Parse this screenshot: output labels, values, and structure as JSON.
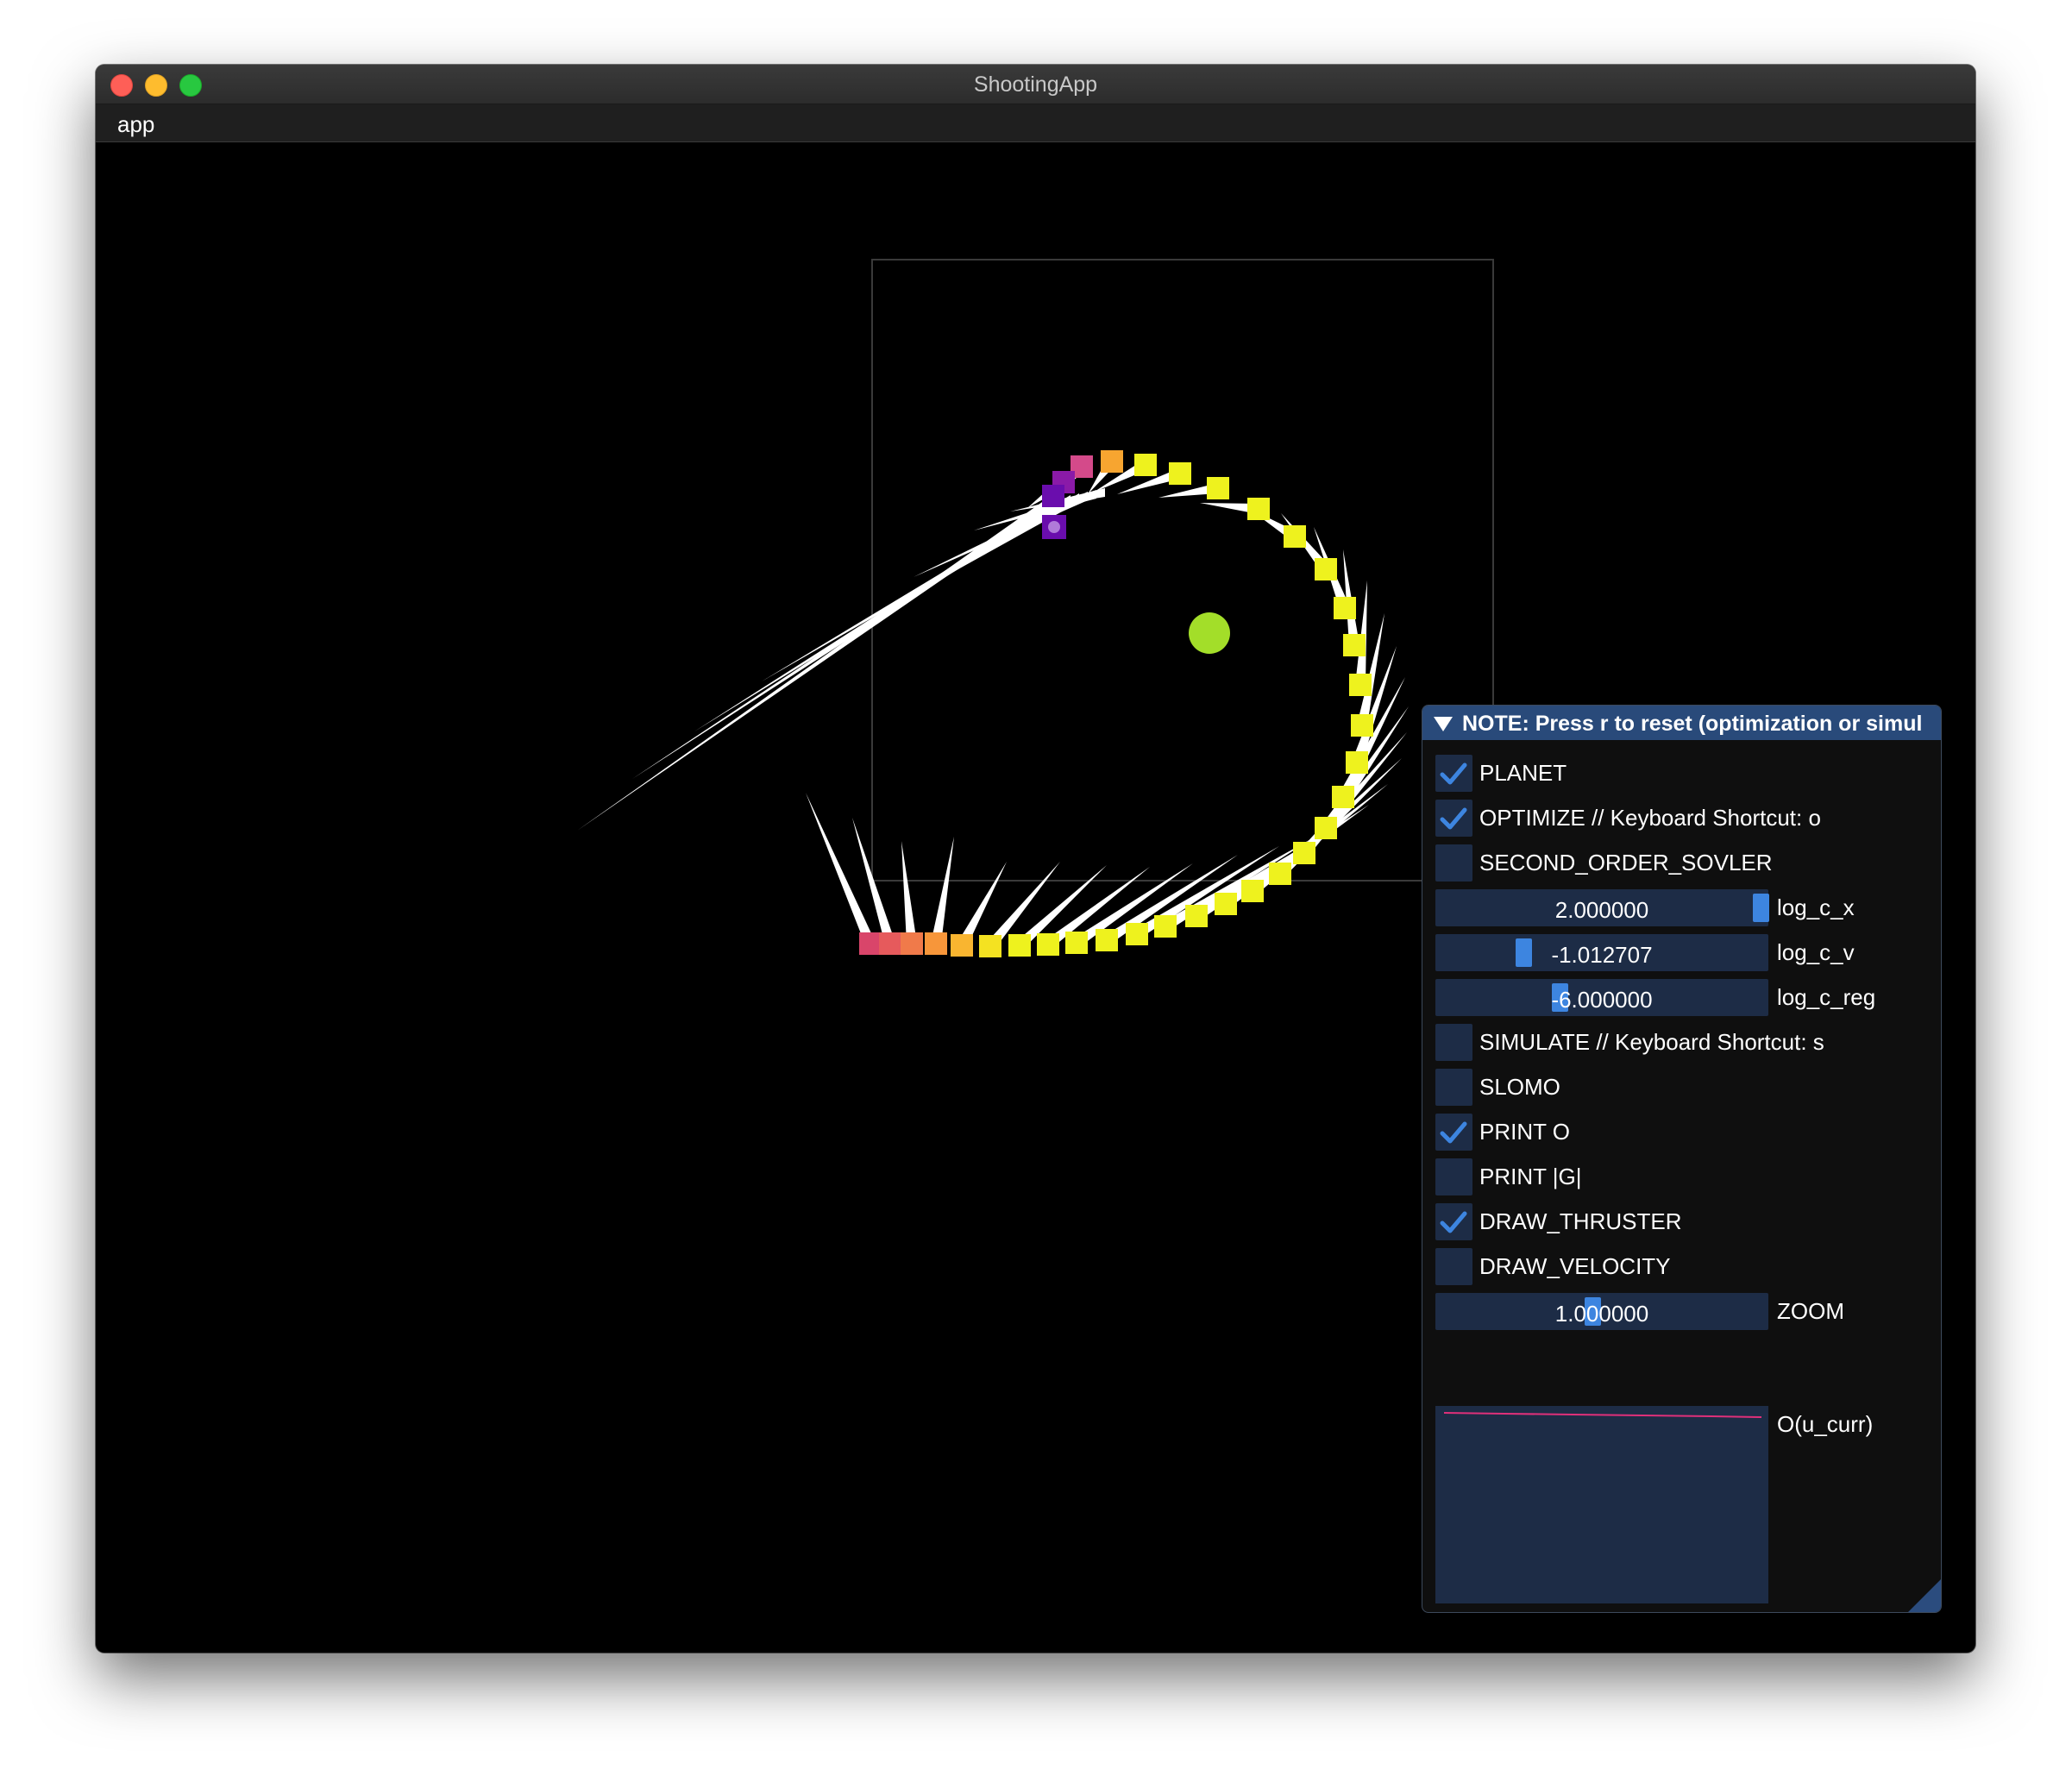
{
  "window": {
    "title": "ShootingApp"
  },
  "menu": {
    "app_label": "app"
  },
  "scene": {
    "planet_color": "#a3de29",
    "thrust_color": "#ffffff",
    "rocket_start_color": "#6a0dad"
  },
  "panel": {
    "header": "NOTE: Press r to reset (optimization or simul",
    "accent_color": "#3d85e0",
    "items": [
      {
        "type": "checkbox",
        "label": "PLANET",
        "checked": true
      },
      {
        "type": "checkbox",
        "label": "OPTIMIZE // Keyboard Shortcut: o",
        "checked": true
      },
      {
        "type": "checkbox",
        "label": "SECOND_ORDER_SOVLER",
        "checked": false
      },
      {
        "type": "slider",
        "value": "2.000000",
        "label": "log_c_x",
        "level": 1.0
      },
      {
        "type": "slider",
        "value": "-1.012707",
        "label": "log_c_v",
        "level": 0.2
      },
      {
        "type": "slider",
        "value": "-6.000000",
        "label": "log_c_reg",
        "level": 0.3
      },
      {
        "type": "checkbox",
        "label": "SIMULATE // Keyboard Shortcut: s",
        "checked": false
      },
      {
        "type": "checkbox",
        "label": "SLOMO",
        "checked": false
      },
      {
        "type": "checkbox",
        "label": "PRINT  O",
        "checked": true
      },
      {
        "type": "checkbox",
        "label": "PRINT |G|",
        "checked": false
      },
      {
        "type": "checkbox",
        "label": "DRAW_THRUSTER",
        "checked": true
      },
      {
        "type": "checkbox",
        "label": "DRAW_VELOCITY",
        "checked": false
      },
      {
        "type": "slider",
        "value": "1.000000",
        "label": "ZOOM",
        "level": 0.5
      }
    ],
    "plot": {
      "label": "O(u_curr)",
      "line_color": "#e0307a"
    }
  }
}
